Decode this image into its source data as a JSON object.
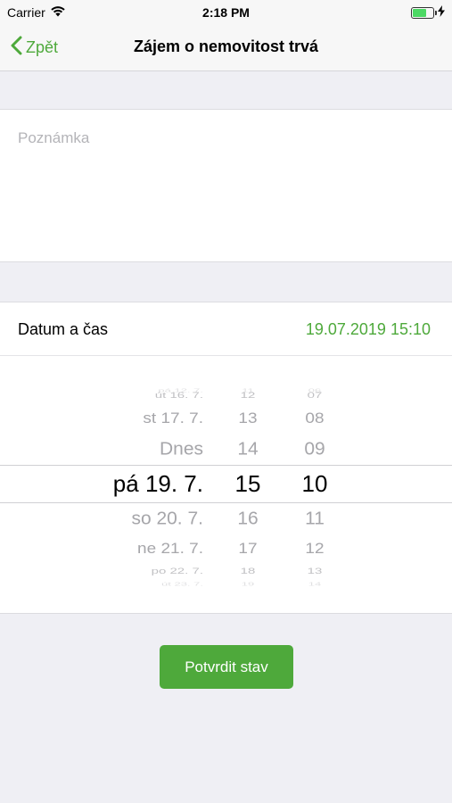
{
  "status_bar": {
    "carrier": "Carrier",
    "time": "2:18 PM",
    "battery_level": 0.7
  },
  "nav": {
    "back_label": "Zpět",
    "title": "Zájem o nemovitost trvá"
  },
  "note": {
    "placeholder": "Poznámka",
    "value": ""
  },
  "date_row": {
    "label": "Datum a čas",
    "value": "19.07.2019 15:10"
  },
  "picker": {
    "days": [
      "pá 12. 7.",
      "út 16. 7.",
      "st 17. 7.",
      "Dnes",
      "pá 19. 7.",
      "so 20. 7.",
      "ne 21. 7.",
      "po 22. 7.",
      "út 23. 7."
    ],
    "hours": [
      "11",
      "12",
      "13",
      "14",
      "15",
      "16",
      "17",
      "18",
      "19"
    ],
    "minutes": [
      "06",
      "07",
      "08",
      "09",
      "10",
      "11",
      "12",
      "13",
      "14"
    ],
    "selected_index": 4
  },
  "confirm_button": {
    "label": "Potvrdit stav"
  },
  "colors": {
    "accent": "#4ea93b",
    "background": "#efeff4"
  }
}
